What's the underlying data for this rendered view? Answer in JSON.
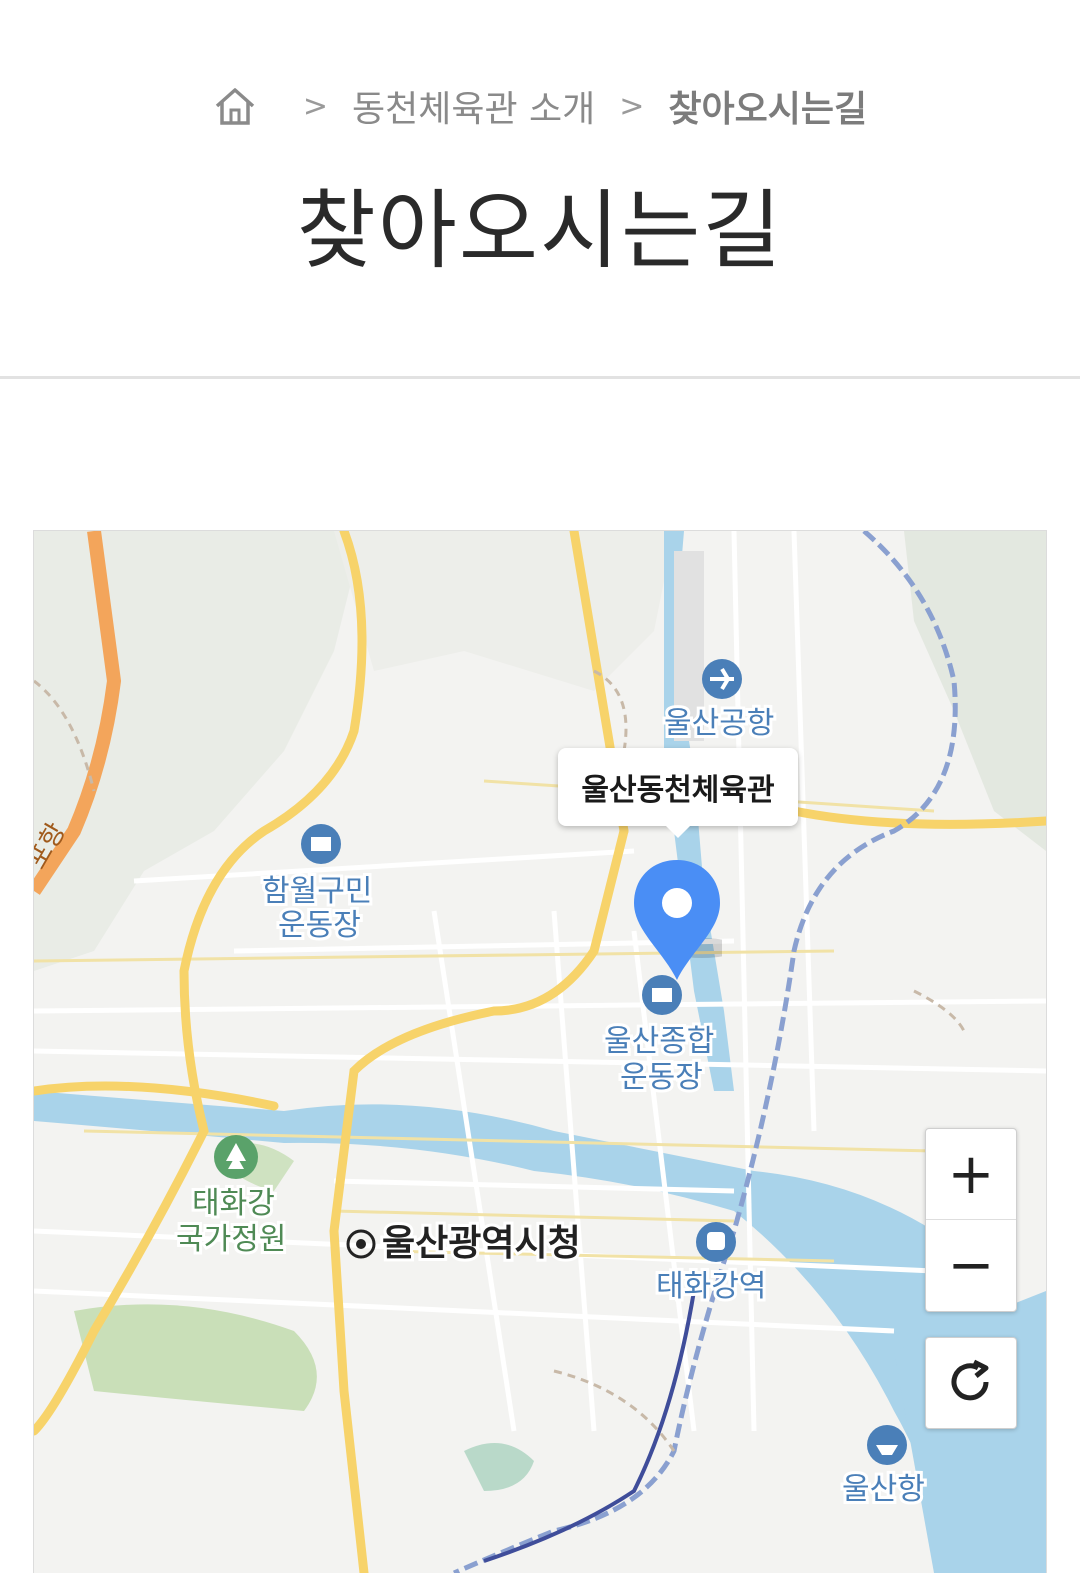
{
  "breadcrumb": {
    "home_icon": "home-icon",
    "separator_icon": "chevron-right-icon",
    "items": [
      "동천체육관 소개",
      "찾아오시는길"
    ]
  },
  "page": {
    "title": "찾아오시는길"
  },
  "map": {
    "marker_label": "울산동천체육관",
    "places": {
      "airport": "울산공항",
      "stadium_hamwol_1": "함월구민",
      "stadium_hamwol_2": "운동장",
      "stadium_ulsan_1": "울산종합",
      "stadium_ulsan_2": "운동장",
      "garden_1": "태화강",
      "garden_2": "국가정원",
      "city_hall": "울산광역시청",
      "station": "태화강역",
      "port": "울산항",
      "road_label": "포항"
    },
    "controls": {
      "zoom_in": "+",
      "zoom_out": "−",
      "refresh_icon": "refresh-icon"
    },
    "colors": {
      "marker": "#4a8ef5",
      "river": "#a9d3ea",
      "road_major": "#f7d36a",
      "highway": "#f3a55b",
      "park": "#c9dfb8",
      "label_blue": "#4a7fb8"
    }
  }
}
